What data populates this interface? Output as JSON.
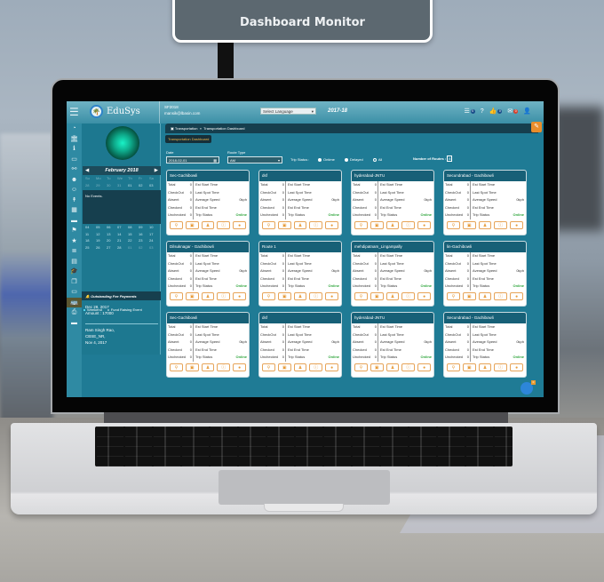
{
  "sign": {
    "title": "Dashboard Monitor"
  },
  "app": {
    "logo_text": "EduSys",
    "user_id": "SF2018",
    "user_email": "mansik@lbasin.com",
    "language_select": "Select Language",
    "academic_year": "2017-18",
    "header_icons": [
      {
        "name": "list-icon",
        "glyph": "☰",
        "badge": "0"
      },
      {
        "name": "help-icon",
        "glyph": "?",
        "badge": ""
      },
      {
        "name": "thumbs-up-icon",
        "glyph": "👍",
        "badge": "0"
      },
      {
        "name": "mail-icon",
        "glyph": "✉",
        "badge": "0"
      },
      {
        "name": "user-icon",
        "glyph": "👤",
        "badge": ""
      }
    ],
    "breadcrumb": {
      "parent": "Transportation",
      "separator": "»",
      "current": "Transportation Dashboard"
    },
    "tab_title": "Transportation Dashboard",
    "icon_rail": [
      {
        "name": "dashboard-icon",
        "glyph": "◔"
      },
      {
        "name": "bank-icon",
        "glyph": "🏛"
      },
      {
        "name": "info-icon",
        "glyph": "ℹ"
      },
      {
        "name": "monitor-icon",
        "glyph": "▭"
      },
      {
        "name": "share-icon",
        "glyph": "⚯"
      },
      {
        "name": "user-add-icon",
        "glyph": "☻"
      },
      {
        "name": "users-icon",
        "glyph": "☺"
      },
      {
        "name": "tie-icon",
        "glyph": "↟"
      },
      {
        "name": "calculator-icon",
        "glyph": "▦"
      },
      {
        "name": "card-icon",
        "glyph": "▬"
      },
      {
        "name": "flag-icon",
        "glyph": "⚑"
      },
      {
        "name": "star-icon",
        "glyph": "★"
      },
      {
        "name": "list-ol-icon",
        "glyph": "≣"
      },
      {
        "name": "file-icon",
        "glyph": "▤"
      },
      {
        "name": "graduation-cap-icon",
        "glyph": "🎓"
      },
      {
        "name": "copy-icon",
        "glyph": "❐"
      },
      {
        "name": "bed-icon",
        "glyph": "▭"
      },
      {
        "name": "bus-icon",
        "glyph": "🚌",
        "active": true
      },
      {
        "name": "print-icon",
        "glyph": "⎙"
      },
      {
        "name": "hotel-icon",
        "glyph": "▬"
      }
    ]
  },
  "calendar": {
    "month": "February 2018",
    "weekdays": [
      "Su",
      "Mo",
      "Tu",
      "We",
      "Th",
      "Fr",
      "Sa"
    ],
    "row1": [
      "28",
      "29",
      "30",
      "31",
      "01",
      "02",
      "03"
    ],
    "events_text": "No Events.",
    "rows": [
      [
        "04",
        "05",
        "06",
        "07",
        "08",
        "09",
        "10"
      ],
      [
        "11",
        "12",
        "13",
        "14",
        "15",
        "16",
        "17"
      ],
      [
        "18",
        "19",
        "20",
        "21",
        "22",
        "23",
        "24"
      ],
      [
        "25",
        "26",
        "27",
        "28",
        "01",
        "02",
        "03"
      ]
    ],
    "legend": [
      "Weekend",
      "Fund Raising Event"
    ]
  },
  "outstanding": {
    "title": "Outstanding Fee Payments",
    "entry1": {
      "date": "Dec 28, 2017",
      "amount": "Amount : 17000"
    },
    "entry2": {
      "name": "Ram Singh Rao,",
      "code": "CBSE_NR,",
      "date": "Nov 4, 2017"
    }
  },
  "filters": {
    "date_label": "Date",
    "date_value": "2018-02-01",
    "route_type_label": "Route Type",
    "route_type_value": "AM",
    "trip_status_label": "Trip Status :",
    "trip_status_options": [
      "Ontime",
      "Delayed",
      "All"
    ],
    "trip_status_selected": "All",
    "routes_count_label": "Number of Routes :",
    "routes_count_value": "8"
  },
  "card_labels": {
    "total": "Total",
    "checkout": "CheckOut",
    "absent": "Absent",
    "checked": "Checked",
    "unchecked": "Unchecked",
    "est_start": "Est Start Time",
    "last_spot": "Last Spot Time",
    "avg_speed": "Average Speed",
    "est_end": "Est End Time",
    "trip_status": "Trip Status"
  },
  "routes": [
    {
      "name": "Sec-Gachibowli",
      "total": "0",
      "checkout": "0",
      "absent": "0",
      "checked": "0",
      "unchecked": "0",
      "speed": "0kph",
      "status": "Online"
    },
    {
      "name": "dsf",
      "total": "0",
      "checkout": "0",
      "absent": "0",
      "checked": "0",
      "unchecked": "0",
      "speed": "0kph",
      "status": "Online"
    },
    {
      "name": "hyderabad-JNTU",
      "total": "0",
      "checkout": "0",
      "absent": "0",
      "checked": "0",
      "unchecked": "0",
      "speed": "0kph",
      "status": "Online"
    },
    {
      "name": "Secundrabad - Gachibowli",
      "total": "0",
      "checkout": "0",
      "absent": "0",
      "checked": "0",
      "unchecked": "0",
      "speed": "0kph",
      "status": "Online"
    },
    {
      "name": "Dilsuknagar - Gachibowli",
      "total": "0",
      "checkout": "0",
      "absent": "0",
      "checked": "0",
      "unchecked": "0",
      "speed": "0kph",
      "status": "Online"
    },
    {
      "name": "Route 1",
      "total": "0",
      "checkout": "0",
      "absent": "0",
      "checked": "0",
      "unchecked": "0",
      "speed": "0kph",
      "status": "Online"
    },
    {
      "name": "mehdipatnam_Lingampally",
      "total": "0",
      "checkout": "0",
      "absent": "0",
      "checked": "0",
      "unchecked": "0",
      "speed": "0kph",
      "status": "Online"
    },
    {
      "name": "lin-Gachibowli",
      "total": "0",
      "checkout": "0",
      "absent": "0",
      "checked": "0",
      "unchecked": "0",
      "speed": "0kph",
      "status": "Online"
    },
    {
      "name": "Sec-Gachibowli",
      "total": "0",
      "checkout": "0",
      "absent": "0",
      "checked": "0",
      "unchecked": "0",
      "speed": "0kph",
      "status": "Online"
    },
    {
      "name": "dsf",
      "total": "0",
      "checkout": "0",
      "absent": "0",
      "checked": "0",
      "unchecked": "0",
      "speed": "0kph",
      "status": "Online"
    },
    {
      "name": "hyderabad-JNTU",
      "total": "0",
      "checkout": "0",
      "absent": "0",
      "checked": "0",
      "unchecked": "0",
      "speed": "0kph",
      "status": "Online"
    },
    {
      "name": "Secundrabad - Gachibowli",
      "total": "0",
      "checkout": "0",
      "absent": "0",
      "checked": "0",
      "unchecked": "0",
      "speed": "0kph",
      "status": "Online"
    }
  ],
  "card_actions": [
    {
      "name": "map-marker-icon",
      "glyph": "⚲"
    },
    {
      "name": "bus-icon",
      "glyph": "▣"
    },
    {
      "name": "person-icon",
      "glyph": "♟"
    },
    {
      "name": "info-icon",
      "glyph": "ⓘ"
    },
    {
      "name": "comment-icon",
      "glyph": "●"
    }
  ],
  "chat_badge": "0",
  "colors": {
    "accent": "#e98d2b",
    "header": "#176077",
    "online": "#2fa53c",
    "screen_bg": "#1f7b95"
  }
}
